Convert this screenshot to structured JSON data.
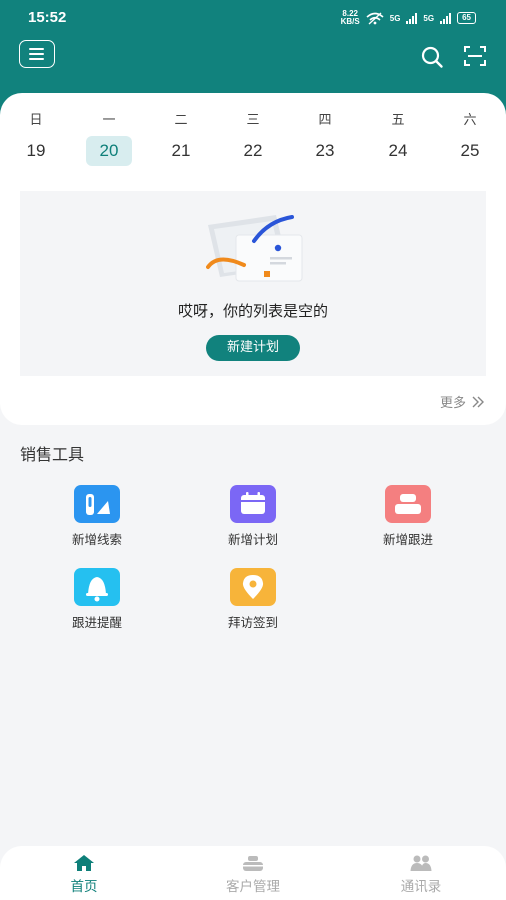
{
  "status_bar": {
    "time": "15:52",
    "net_speed_value": "8.22",
    "net_speed_unit": "KB/S",
    "sim1": "5G",
    "sim2": "5G",
    "battery": "65"
  },
  "header": {
    "menu_icon": "menu-icon",
    "search_icon": "search-icon",
    "scan_icon": "scan-icon"
  },
  "calendar": {
    "weekdays": [
      "日",
      "一",
      "二",
      "三",
      "四",
      "五",
      "六"
    ],
    "dates": [
      "19",
      "20",
      "21",
      "22",
      "23",
      "24",
      "25"
    ],
    "selected_index": 1
  },
  "empty_state": {
    "message": "哎呀，你的列表是空的",
    "button": "新建计划"
  },
  "more_link": "更多",
  "sales_tools": {
    "title": "销售工具",
    "items": [
      {
        "label": "新增线索",
        "icon": "lead-icon",
        "color": "#2b95f0"
      },
      {
        "label": "新增计划",
        "icon": "calendar-icon",
        "color": "#7b67f5"
      },
      {
        "label": "新增跟进",
        "icon": "follow-up-icon",
        "color": "#f47f80"
      },
      {
        "label": "跟进提醒",
        "icon": "bell-icon",
        "color": "#25c0f0"
      },
      {
        "label": "拜访签到",
        "icon": "location-icon",
        "color": "#f7b43a"
      }
    ]
  },
  "tabbar": {
    "items": [
      {
        "label": "首页",
        "icon": "home-icon",
        "active": true
      },
      {
        "label": "客户管理",
        "icon": "customer-icon",
        "active": false
      },
      {
        "label": "通讯录",
        "icon": "contacts-icon",
        "active": false
      }
    ]
  },
  "colors": {
    "primary": "#11827d",
    "selected_bg": "#d8edef"
  }
}
